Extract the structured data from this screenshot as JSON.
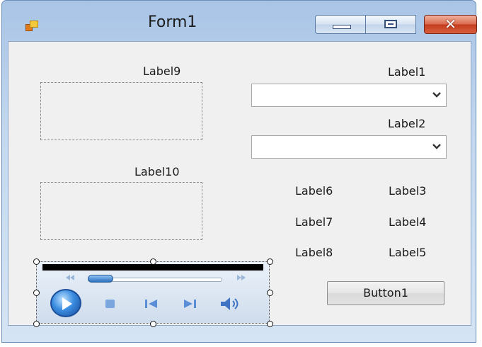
{
  "window": {
    "title": "Form1"
  },
  "labels": {
    "label9": "Label9",
    "label10": "Label10",
    "label1": "Label1",
    "label2": "Label2",
    "label3": "Label3",
    "label4": "Label4",
    "label5": "Label5",
    "label6": "Label6",
    "label7": "Label7",
    "label8": "Label8"
  },
  "combo1": {
    "value": ""
  },
  "combo2": {
    "value": ""
  },
  "button1": {
    "label": "Button1"
  },
  "media_player": {
    "seek_position": 0.1
  },
  "colors": {
    "titlebar": "#c4d8ef",
    "close_button": "#c43b1d",
    "client": "#f0f0f0",
    "player_accent": "#2d6fbf"
  },
  "icons": [
    "app-icon",
    "minimize-icon",
    "maximize-icon",
    "close-icon",
    "chevron-down-icon",
    "play-icon",
    "stop-icon",
    "previous-icon",
    "next-icon",
    "volume-icon",
    "rewind-icon",
    "fast-forward-icon"
  ]
}
